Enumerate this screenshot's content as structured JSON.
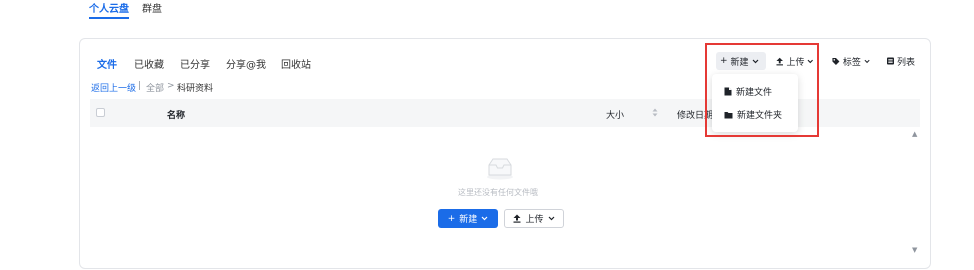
{
  "top_tabs": [
    {
      "label": "个人云盘",
      "active": true
    },
    {
      "label": "群盘",
      "active": false
    }
  ],
  "file_tabs": [
    {
      "label": "文件",
      "active": true
    },
    {
      "label": "已收藏",
      "active": false
    },
    {
      "label": "已分享",
      "active": false
    },
    {
      "label": "分享@我",
      "active": false
    },
    {
      "label": "回收站",
      "active": false
    }
  ],
  "toolbar": {
    "new_label": "新建",
    "upload_label": "上传",
    "tags_label": "标签",
    "list_label": "列表"
  },
  "breadcrumb": {
    "back_label": "返回上一级",
    "separator": "|",
    "root_label": "全部",
    "arrow": ">",
    "current_label": "科研资料"
  },
  "table": {
    "columns": [
      "名称",
      "大小",
      "修改日期"
    ]
  },
  "empty_state": {
    "text": "这里还没有任何文件哦",
    "new_button_label": "新建",
    "upload_button_label": "上传"
  },
  "new_menu": {
    "items": [
      "新建文件",
      "新建文件夹"
    ]
  },
  "colors": {
    "accent": "#1b6ce8",
    "highlight_border": "#e53935"
  }
}
